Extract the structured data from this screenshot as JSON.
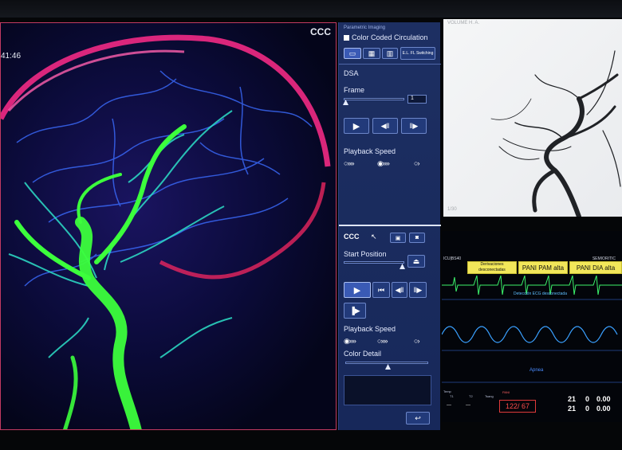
{
  "viewer": {
    "label_mode": "CCC",
    "label_time": "41:46",
    "colors": {
      "artery_green": "#3cff3c",
      "vein_magenta": "#ff2b8a",
      "cyan": "#2de0c8",
      "blue": "#2f6bff"
    }
  },
  "panel": {
    "parametric_label": "Parametric Imaging",
    "color_coded_label": "Color Coded Circulation",
    "switching_label": "E.L. FL Switching",
    "dsa_title": "DSA",
    "frame_label": "Frame",
    "frame_value": "1",
    "playback_speed_label": "Playback Speed",
    "ccc_title": "CCC",
    "start_position_label": "Start Position",
    "playback_speed_label_2": "Playback Speed",
    "color_detail_label": "Color Detail",
    "icons": {
      "play": "▶",
      "step_back": "◀‖",
      "step_fwd": "‖▶",
      "first": "⏮",
      "fast": "»»",
      "faster": "»»",
      "slow": "›",
      "camera": "camera-icon",
      "save": "save-icon",
      "return": "return-icon"
    },
    "accent": "#3a5ab5"
  },
  "xray": {
    "caption_top": "VOLUME  H. A.",
    "caption_bottom": "1/30"
  },
  "monitor": {
    "bed_id": "ICU|BS40",
    "sensor_label": "SEMIORITIC",
    "alarms": [
      "Derivaciones desconectadas",
      "PANI PAM alta",
      "PANI DIA alta"
    ],
    "note": "Detección ECG desconectada",
    "apnea": "Apnea",
    "nibp_value": "122/ 67",
    "num_a": "21",
    "num_b": "21",
    "num_c": "0",
    "num_d": "0",
    "num_e": "0.00",
    "num_f": "0.00",
    "label_temp": "Temp",
    "label_t1": "T1",
    "label_t2": "T2",
    "label_tsang": "Tsang",
    "label_ibp": "PANI",
    "dash": "---"
  }
}
